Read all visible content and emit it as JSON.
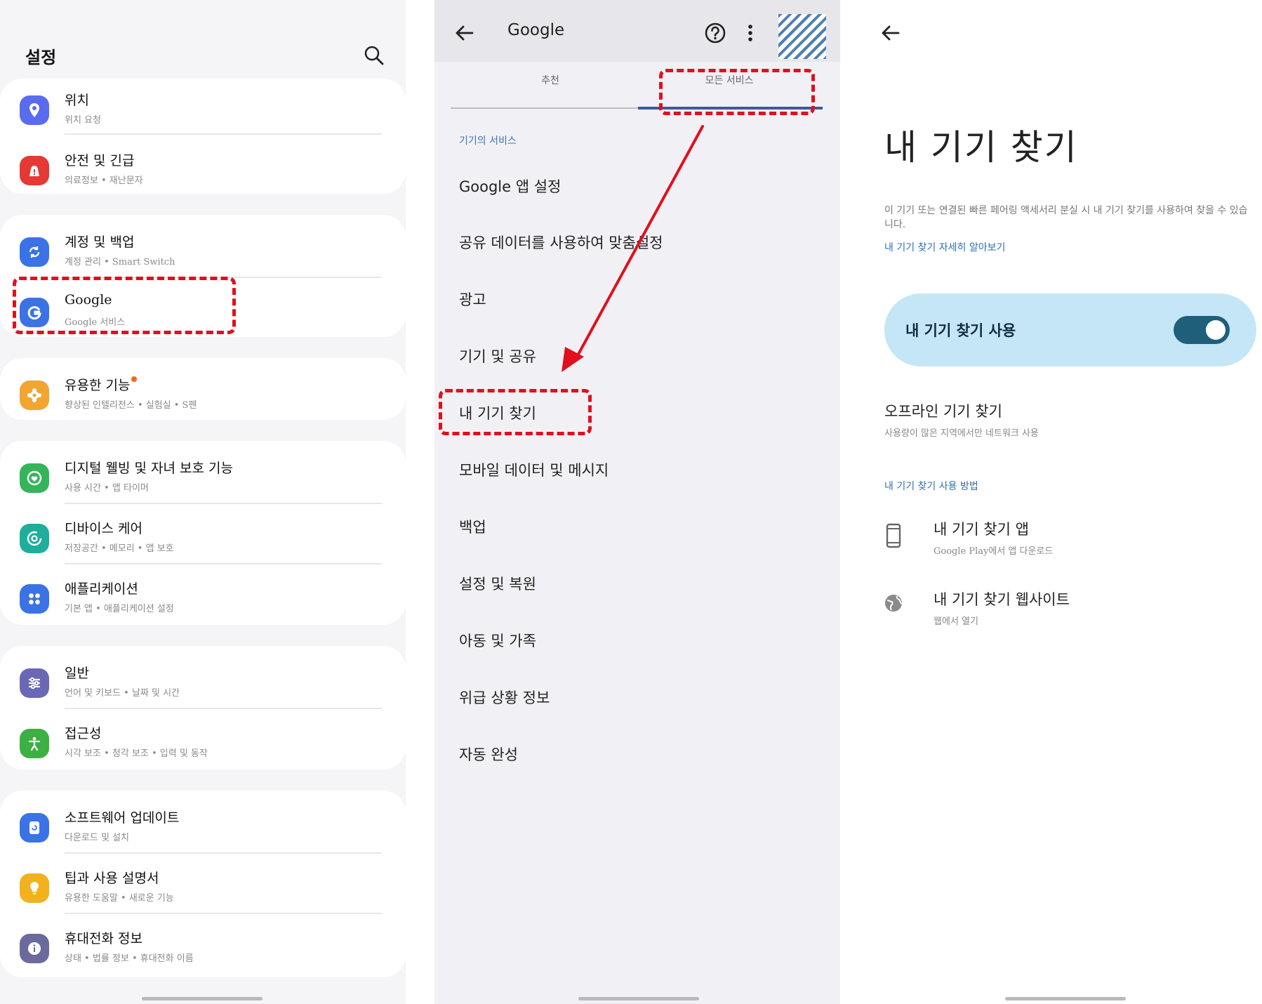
{
  "settings": {
    "title": "설정",
    "items": [
      {
        "title": "위치",
        "subtitle": "위치 요청",
        "icon": "location-pin-icon",
        "color": "#5b6bf0"
      },
      {
        "title": "안전 및 긴급",
        "subtitle": "의료정보 • 재난문자",
        "icon": "emergency-icon",
        "color": "#e53935"
      },
      {
        "title": "계정 및 백업",
        "subtitle": "계정 관리 • Smart Switch",
        "icon": "sync-icon",
        "color": "#3b73e6"
      },
      {
        "title": "Google",
        "subtitle": "Google 서비스",
        "icon": "google-g-icon",
        "color": "#3b73e6"
      },
      {
        "title": "유용한 기능",
        "subtitle": "향상된 인텔리전스 • 실험실 • S펜",
        "icon": "puzzle-icon",
        "color": "#f2a531"
      },
      {
        "title": "디지털 웰빙 및 자녀 보호 기능",
        "subtitle": "사용 시간 • 앱 타이머",
        "icon": "wellbeing-icon",
        "color": "#34b55a"
      },
      {
        "title": "디바이스 케어",
        "subtitle": "저장공간 • 메모리 • 앱 보호",
        "icon": "device-care-icon",
        "color": "#1fae9c"
      },
      {
        "title": "애플리케이션",
        "subtitle": "기본 앱 • 애플리케이션 설정",
        "icon": "apps-grid-icon",
        "color": "#3b73e6"
      },
      {
        "title": "일반",
        "subtitle": "언어 및 키보드 • 날짜 및 시간",
        "icon": "sliders-icon",
        "color": "#6a68b4"
      },
      {
        "title": "접근성",
        "subtitle": "시각 보조 • 청각 보조 • 입력 및 동작",
        "icon": "accessibility-icon",
        "color": "#3cb043"
      },
      {
        "title": "소프트웨어 업데이트",
        "subtitle": "다운로드 및 설치",
        "icon": "update-icon",
        "color": "#3b73e6"
      },
      {
        "title": "팁과 사용 설명서",
        "subtitle": "유용한 도움말 • 새로운 기능",
        "icon": "lightbulb-icon",
        "color": "#f2b21f"
      },
      {
        "title": "휴대전화 정보",
        "subtitle": "상태 • 법률 정보 • 휴대전화 이름",
        "icon": "info-icon",
        "color": "#6a6a9c"
      }
    ]
  },
  "google": {
    "title": "Google",
    "tabs": [
      "추천",
      "모든 서비스"
    ],
    "active_tab": "모든 서비스",
    "section": "기기의 서비스",
    "items": [
      "Google 앱 설정",
      "공유 데이터를 사용하여 맞춤설정",
      "광고",
      "기기 및 공유",
      "내 기기 찾기",
      "모바일 데이터 및 메시지",
      "백업",
      "설정 및 복원",
      "아동 및 가족",
      "위급 상황 정보",
      "자동 완성"
    ]
  },
  "find": {
    "title": "내 기기 찾기",
    "description": "이 기기 또는 연결된 빠른 페어링 액세서리 분실 시 내 기기 찾기를 사용하여 찾을 수 있습니다.",
    "learn_more": "내 기기 찾기 자세히 알아보기",
    "toggle_label": "내 기기 찾기 사용",
    "toggle_on": true,
    "offline_title": "오프라인 기기 찾기",
    "offline_subtitle": "사용량이 많은 지역에서만 네트워크 사용",
    "howto_header": "내 기기 찾기 사용 방법",
    "app_title": "내 기기 찾기 앱",
    "app_subtitle": "Google Play에서 앱 다운로드",
    "web_title": "내 기기 찾기 웹사이트",
    "web_subtitle": "웹에서 열기"
  },
  "colors": {
    "highlight": "#e0101e",
    "arrow": "#e0101e",
    "accent_blue": "#3f74b8",
    "toggle_bg": "#c5e6f7",
    "switch_on": "#1f5f7a"
  }
}
